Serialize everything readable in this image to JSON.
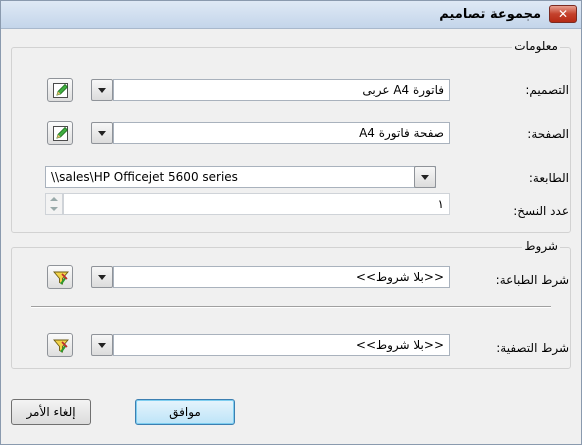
{
  "window": {
    "title": "مجموعة تصاميم",
    "close_label": "✕"
  },
  "info_group": {
    "legend": "معلومات",
    "design_label": "التصميم:",
    "design_value": "فاتورة A4 عربى",
    "page_label": "الصفحة:",
    "page_value": "صفحة فاتورة A4",
    "printer_label": "الطابعة:",
    "printer_value": "\\\\sales\\HP Officejet 5600 series",
    "copies_label": "عدد النسخ:",
    "copies_value": "١"
  },
  "conditions_group": {
    "legend": "شروط",
    "print_condition_label": "شرط الطباعة:",
    "print_condition_value": "<<بلا شروط>>",
    "filter_condition_label": "شرط التصفية:",
    "filter_condition_value": "<<بلا شروط>>"
  },
  "buttons": {
    "ok": "موافق",
    "cancel": "إلغاء الأمر"
  },
  "icons": {
    "edit": "edit-design-icon",
    "filter": "funnel-filter-icon",
    "close": "close-icon",
    "dropdown": "chevron-down-icon"
  }
}
